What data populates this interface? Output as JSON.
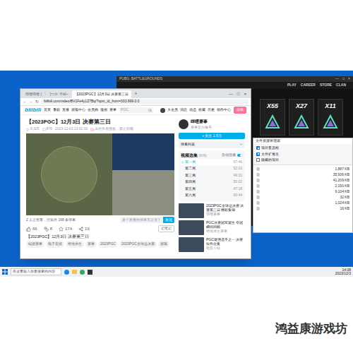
{
  "browser": {
    "tabs": [
      {
        "label": "哔哩哔哩 (゜-゜)つロ 干杯~",
        "selected": false
      },
      {
        "label": "【2023PGC】12月3日 决赛第三日",
        "selected": true
      }
    ],
    "new_tab": "+",
    "controls": [
      "—",
      "□",
      "×"
    ],
    "nav": [
      "←",
      "→",
      "↻"
    ],
    "url": "bilibili.com/video/BV1Fe4y1Z7Bq/?spm_id_from=333.999.0.0"
  },
  "site_header": {
    "logo": "bilibili",
    "nav": [
      "首页",
      "番剧",
      "直播",
      "游戏中心",
      "会员购",
      "漫画",
      "赛事"
    ],
    "search_placeholder": "PGC",
    "user_links": [
      "大会员",
      "消息",
      "动态",
      "收藏",
      "历史",
      "创作中心"
    ],
    "upload": "投稿"
  },
  "video": {
    "title": "【2023PGC】12月3日 决赛第三日",
    "views": "8,325",
    "danmaku_count": "876",
    "date": "2023-12-03 13:01:00",
    "notice": "未经作者授权，禁止转载",
    "viewers": "2 人正在看，已装填 168 条弹幕",
    "danmaku_placeholder": "发个友善的弹幕见证当下",
    "send": "发送",
    "likes": "66",
    "coins": "8",
    "favorites": "174",
    "shares": "19",
    "note": "记笔记",
    "description": "【2023PGC】12月3日 决赛第三日",
    "tags": [
      "端游赛事",
      "电子竞技",
      "绝地求生",
      "赛事",
      "2023PGC",
      "2023PGC全球总决赛",
      "游戏"
    ]
  },
  "uploader": {
    "name": "哔哩赛事",
    "desc": "赛事官方账号",
    "follow": "+ 关注 1.5万"
  },
  "danmaku_list": "弹幕列表",
  "playlist": {
    "title": "视频选集",
    "count": "(6/6)",
    "autoplay": "自动连播",
    "autoplay_on": true,
    "items": [
      {
        "label": "第一局",
        "duration": "57:46",
        "selected": true
      },
      {
        "label": "第二局",
        "duration": "52:10",
        "selected": false
      },
      {
        "label": "第三局",
        "duration": "49:31",
        "selected": false
      },
      {
        "label": "第四局",
        "duration": "55:02",
        "selected": false
      },
      {
        "label": "第五局",
        "duration": "47:18",
        "selected": false
      },
      {
        "label": "第六局",
        "duration": "50:44",
        "selected": false
      }
    ]
  },
  "recommended": [
    {
      "title": "2023PGC全球总决赛 决赛第三日 精彩集锦",
      "author": "哔哩赛事"
    },
    {
      "title": "PGC决赛冠军诞生 夺冠瞬间回顾",
      "author": "绝地求生赛事"
    },
    {
      "title": "PGC最强选手之一 决赛操作合集",
      "author": "电竞小站"
    }
  ],
  "game_window": {
    "title": "PUBG: BATTLEGROUNDS",
    "controls": [
      "—",
      "□",
      "×"
    ],
    "menu": [
      "PLAY",
      "CAREER",
      "STORE",
      "CLAN"
    ],
    "cards": [
      "X55",
      "X27",
      "X11"
    ]
  },
  "explorer": {
    "title": "文件资源管理器",
    "options": [
      {
        "label": "项目复选框",
        "checked": true
      },
      {
        "label": "文件扩展名",
        "checked": true
      },
      {
        "label": "隐藏的项目",
        "checked": false
      }
    ],
    "rows": [
      "1,887 KB",
      "35,936 KB",
      "41,209 KB",
      "2,150 KB",
      "9,104 KB",
      "32 KB",
      "1,024 KB",
      "16 KB"
    ]
  },
  "taskbar": {
    "search": "在这里输入你要搜索的内容",
    "time": "14:08",
    "date": "2023/12/3"
  },
  "watermark": "鸿益康游戏坊"
}
